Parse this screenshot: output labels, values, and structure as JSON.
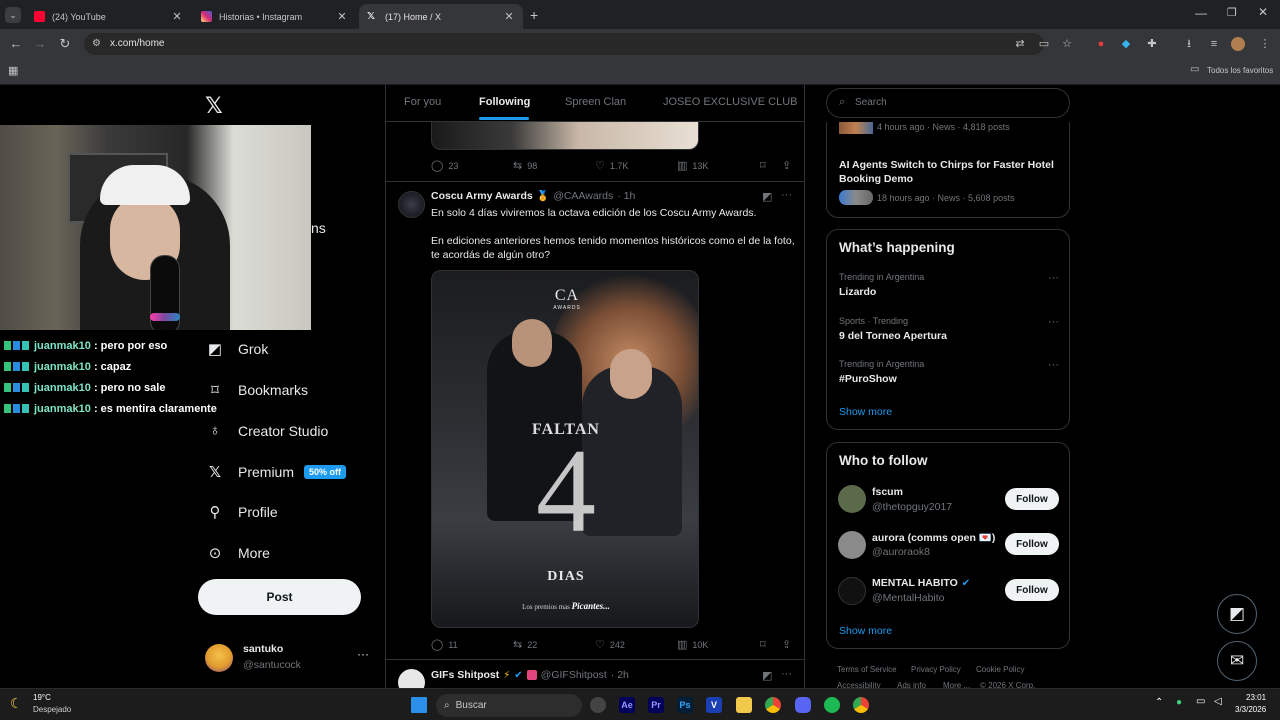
{
  "browser": {
    "tabs": [
      {
        "title": "(24) YouTube",
        "icon": "youtube-icon",
        "color": "#ff0033",
        "active": false
      },
      {
        "title": "Historias • Instagram",
        "icon": "instagram-icon",
        "color": "#d62976",
        "active": false
      },
      {
        "title": "(17) Home / X",
        "icon": "x-icon",
        "color": "#ffffff",
        "active": true
      }
    ],
    "url": "x.com/home",
    "bookmarks_label": "Todos los favoritos"
  },
  "stream_chat": [
    {
      "user": "juanmak10",
      "message": ": pero por eso"
    },
    {
      "user": "juanmak10",
      "message": ": capaz"
    },
    {
      "user": "juanmak10",
      "message": ": pero no sale"
    },
    {
      "user": "juanmak10",
      "message": ": es mentira claramente"
    }
  ],
  "sidebar": {
    "partial_label": "ns",
    "items": [
      {
        "label": "Grok",
        "icon": "grok-icon"
      },
      {
        "label": "Bookmarks",
        "icon": "bookmark-icon"
      },
      {
        "label": "Creator Studio",
        "icon": "creator-studio-icon"
      },
      {
        "label": "Premium",
        "icon": "x-icon",
        "badge": "50% off"
      },
      {
        "label": "Profile",
        "icon": "person-icon"
      },
      {
        "label": "More",
        "icon": "more-circle-icon"
      }
    ],
    "post_label": "Post",
    "account": {
      "name": "santuko",
      "handle": "@santucock"
    }
  },
  "feed": {
    "tabs": [
      "For you",
      "Following",
      "Spreen Clan",
      "JOSEO EXCLUSIVE CLUB"
    ],
    "active_tab": "Following",
    "prev_post_actions": {
      "replies": "23",
      "reposts": "98",
      "likes": "1.7K",
      "views": "13K"
    },
    "post": {
      "name": "Coscu Army Awards",
      "handle": "@CAAwards",
      "time": "· 1h",
      "text1": "En solo 4 días viviremos la octava edición de los Coscu Army Awards.",
      "text2": "En ediciones anteriores hemos tenido momentos históricos como el de la foto, te acordás de algún otro?",
      "image": {
        "logo": "CA",
        "logo_sub": "AWARDS",
        "faltan": "FALTAN",
        "number": "4",
        "dias": "DIAS",
        "tagline_a": "Los premios mas",
        "tagline_b": "Picantes..."
      },
      "actions": {
        "replies": "11",
        "reposts": "22",
        "likes": "242",
        "views": "10K"
      }
    },
    "next_post": {
      "name": "GIFs Shitpost",
      "handle": "@GIFShitpost",
      "time": "· 2h"
    }
  },
  "right": {
    "search_placeholder": "Search",
    "trending_news": [
      {
        "meta": "4 hours ago · News · 4,818 posts"
      },
      {
        "title": "AI Agents Switch to Chirps for Faster Hotel Booking Demo",
        "meta": "18 hours ago · News · 5,608 posts"
      }
    ],
    "whats_happening": {
      "title": "What’s happening",
      "trends": [
        {
          "category": "Trending in Argentina",
          "name": "Lizardo"
        },
        {
          "category": "Sports · Trending",
          "name": "9 del Torneo Apertura"
        },
        {
          "category": "Trending in Argentina",
          "name": "#PuroShow"
        }
      ],
      "show_more": "Show more"
    },
    "who_to_follow": {
      "title": "Who to follow",
      "accounts": [
        {
          "name": "fscum",
          "handle": "@thetopguy2017",
          "avatar_color": "#5a6a4a"
        },
        {
          "name": "aurora (comms open 💌)",
          "handle": "@auroraok8",
          "avatar_color": "#8a8a8a"
        },
        {
          "name": "MENTAL HABITO",
          "handle": "@MentalHabito",
          "avatar_color": "#111111"
        }
      ],
      "follow_label": "Follow",
      "show_more": "Show more"
    },
    "footer": [
      "Terms of Service",
      "Privacy Policy",
      "Cookie Policy",
      "Accessibility",
      "Ads info",
      "More ...",
      "© 2026 X Corp."
    ]
  },
  "taskbar": {
    "weather_temp": "19°C",
    "weather_desc": "Despejado",
    "search_label": "Buscar",
    "time": "23:01",
    "date": "3/3/2026"
  },
  "colors": {
    "accent": "#1d9bf0",
    "bg": "#000000",
    "border": "#2f3336",
    "muted": "#71767b"
  }
}
